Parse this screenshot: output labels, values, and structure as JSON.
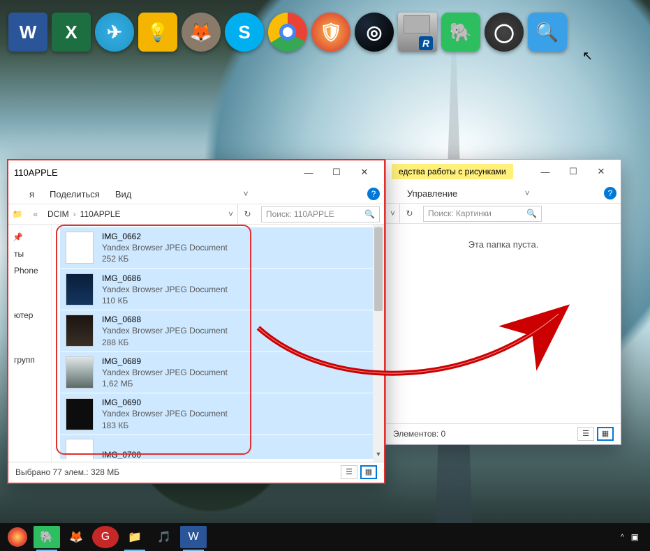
{
  "dock": [
    "W",
    "X",
    "✈",
    "💡",
    "🦊",
    "S",
    "",
    "🛡",
    "◎",
    "R",
    "🐘",
    "◯",
    "🔍"
  ],
  "leftWin": {
    "title": "110APPLE",
    "tabs": {
      "t1": "я",
      "t2": "Поделиться",
      "t3": "Вид"
    },
    "crumbs": {
      "c1": "DCIM",
      "c2": "110APPLE"
    },
    "searchPlaceholder": "Поиск: 110APPLE",
    "nav": {
      "pin": "📌",
      "n1": "ты",
      "n2": "Phone",
      "n3": "ютер",
      "n4": "групп"
    },
    "files": [
      {
        "name": "IMG_0662",
        "type": "Yandex Browser JPEG Document",
        "size": "252 КБ",
        "thumb": ""
      },
      {
        "name": "IMG_0686",
        "type": "Yandex Browser JPEG Document",
        "size": "110 КБ",
        "thumb": "dark"
      },
      {
        "name": "IMG_0688",
        "type": "Yandex Browser JPEG Document",
        "size": "288 КБ",
        "thumb": "dk2"
      },
      {
        "name": "IMG_0689",
        "type": "Yandex Browser JPEG Document",
        "size": "1,62 МБ",
        "thumb": "fog"
      },
      {
        "name": "IMG_0690",
        "type": "Yandex Browser JPEG Document",
        "size": "183 КБ",
        "thumb": "blk"
      }
    ],
    "partial": "IMG_0700",
    "status": "Выбрано 77 элем.: 328 МБ"
  },
  "rightWin": {
    "contextTab": "едства работы с рисунками",
    "manage": "Управление",
    "searchPlaceholder": "Поиск: Картинки",
    "empty": "Эта папка пуста.",
    "status": "Элементов: 0"
  },
  "glyph": {
    "min": "—",
    "max": "☐",
    "close": "✕",
    "back": "«",
    "fwd": "›",
    "drop": "˅",
    "refresh": "↻",
    "mag": "🔍",
    "help": "?",
    "chev": "˅",
    "up": "^"
  }
}
